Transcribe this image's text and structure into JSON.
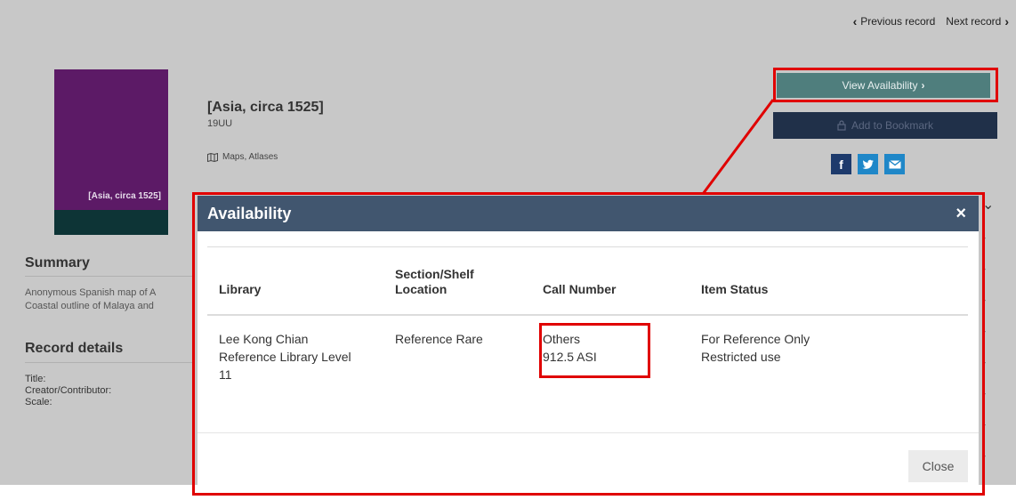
{
  "nav": {
    "previous": "Previous record",
    "next": "Next record"
  },
  "cover": {
    "title": "[Asia, circa 1525]",
    "color": "#5c1a66"
  },
  "record": {
    "title": "[Asia, circa 1525]",
    "date": "19UU",
    "format": "Maps, Atlases"
  },
  "actions": {
    "view_availability": "View Availability",
    "add_bookmark": "Add to Bookmark",
    "share": {
      "facebook": "f",
      "twitter": "t",
      "email": "email"
    }
  },
  "summary": {
    "heading": "Summary",
    "lines": [
      "Anonymous Spanish map of A",
      "Coastal outline of Malaya and"
    ]
  },
  "record_details": {
    "heading": "Record details",
    "labels": [
      "Title:",
      "Creator/Contributor:",
      "Scale:"
    ]
  },
  "modal": {
    "title": "Availability",
    "close_x": "×",
    "columns": [
      [
        "Library"
      ],
      [
        "Section/Shelf",
        "Location"
      ],
      [
        "Call Number"
      ],
      [
        "Item Status"
      ]
    ],
    "rows": [
      {
        "library": [
          "Lee Kong Chian",
          "Reference Library Level",
          "11"
        ],
        "section": [
          "Reference Rare"
        ],
        "call_number": [
          "Others",
          "912.5 ASI"
        ],
        "status": [
          "For Reference Only",
          "Restricted use"
        ]
      }
    ],
    "close_button": "Close"
  },
  "colors": {
    "accent_teal": "#4f7e7d",
    "navy": "#203049",
    "modal_header": "#41566f",
    "highlight": "#e00000"
  }
}
